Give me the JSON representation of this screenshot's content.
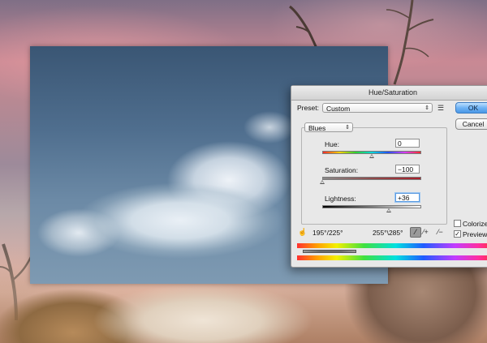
{
  "dialog": {
    "title": "Hue/Saturation",
    "preset_label": "Preset:",
    "preset_value": "Custom",
    "ok_label": "OK",
    "cancel_label": "Cancel",
    "channel_value": "Blues",
    "hue": {
      "label": "Hue:",
      "value": "0",
      "fraction": 0.5
    },
    "saturation": {
      "label": "Saturation:",
      "value": "−100",
      "fraction": 0.0
    },
    "lightness": {
      "label": "Lightness:",
      "value": "+36",
      "fraction": 0.68
    },
    "range_left": "195°/225°",
    "range_right": "255°\\285°",
    "colorize_label": "Colorize",
    "colorize_checked": false,
    "preview_label": "Preview",
    "preview_checked": true,
    "preview_check_glyph": "✓"
  },
  "icons": {
    "preset_options": "preset-options-icon",
    "hand_adjust": "hand-adjust-icon",
    "eyedropper": "eyedropper-icon",
    "eyedropper_plus": "eyedropper-plus-icon",
    "eyedropper_minus": "eyedropper-minus-icon"
  },
  "colors": {
    "ok_button": "#4a98e6",
    "dialog_bg": "#e8e8e8",
    "focus_ring": "#5b9be0"
  }
}
